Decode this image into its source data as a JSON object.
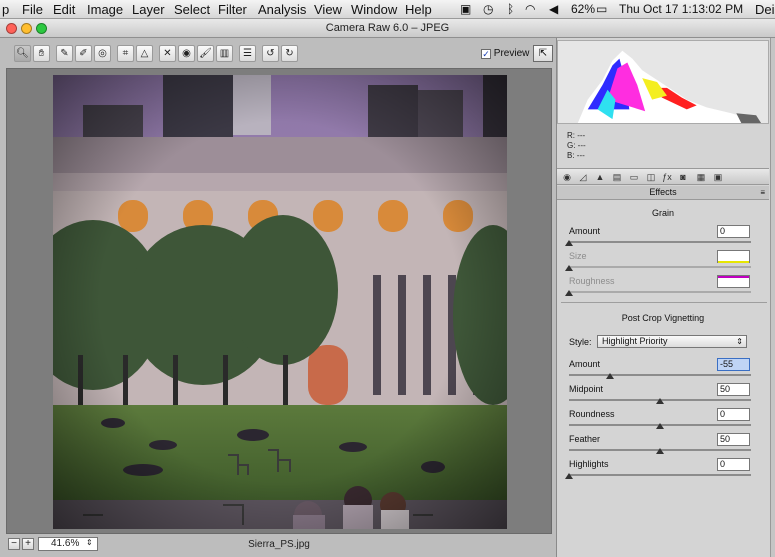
{
  "menubar": {
    "app_cut": "p",
    "items": [
      "File",
      "Edit",
      "Image",
      "Layer",
      "Select",
      "Filter",
      "Analysis",
      "View",
      "Window",
      "Help"
    ],
    "battery": "62%",
    "clock": "Thu Oct 17  1:13:02 PM",
    "user_cut": "Dei"
  },
  "window": {
    "title": "Camera Raw 6.0 – JPEG"
  },
  "toolbar": {
    "tools": [
      "zoom-tool-icon",
      "hand-tool-icon",
      "white-balance-tool-icon",
      "color-sampler-tool-icon",
      "target-adjustment-tool-icon",
      "crop-tool-icon",
      "straighten-tool-icon",
      "spot-removal-tool-icon",
      "red-eye-tool-icon",
      "adjustment-brush-icon",
      "graduated-filter-icon",
      "preferences-icon",
      "rotate-ccw-icon",
      "rotate-cw-icon"
    ],
    "preview_label": "Preview",
    "preview_checked": true
  },
  "canvas": {
    "zoom": "41.6%",
    "filename": "Sierra_PS.jpg"
  },
  "info": {
    "r": "R:  ---",
    "g": "G:  ---",
    "b": "B:  ---"
  },
  "panel": {
    "title": "Effects",
    "grain": {
      "heading": "Grain",
      "amount_label": "Amount",
      "amount": "0",
      "amount_level": 0,
      "size_label": "Size",
      "size_level": 0,
      "roughness_label": "Roughness",
      "roughness_level": 0
    },
    "vignette": {
      "heading": "Post Crop Vignetting",
      "style_label": "Style:",
      "style_value": "Highlight Priority",
      "amount_label": "Amount",
      "amount": "-55",
      "amount_level": 0.225,
      "midpoint_label": "Midpoint",
      "midpoint": "50",
      "midpoint_level": 0.5,
      "roundness_label": "Roundness",
      "roundness": "0",
      "roundness_level": 0.5,
      "feather_label": "Feather",
      "feather": "50",
      "feather_level": 0.5,
      "highlights_label": "Highlights",
      "highlights": "0",
      "highlights_level": 0
    }
  },
  "colors": {
    "size_swatch": "#e6e600",
    "roughness_swatch": "#c000c0",
    "focus_field": "#bfd4f5"
  }
}
